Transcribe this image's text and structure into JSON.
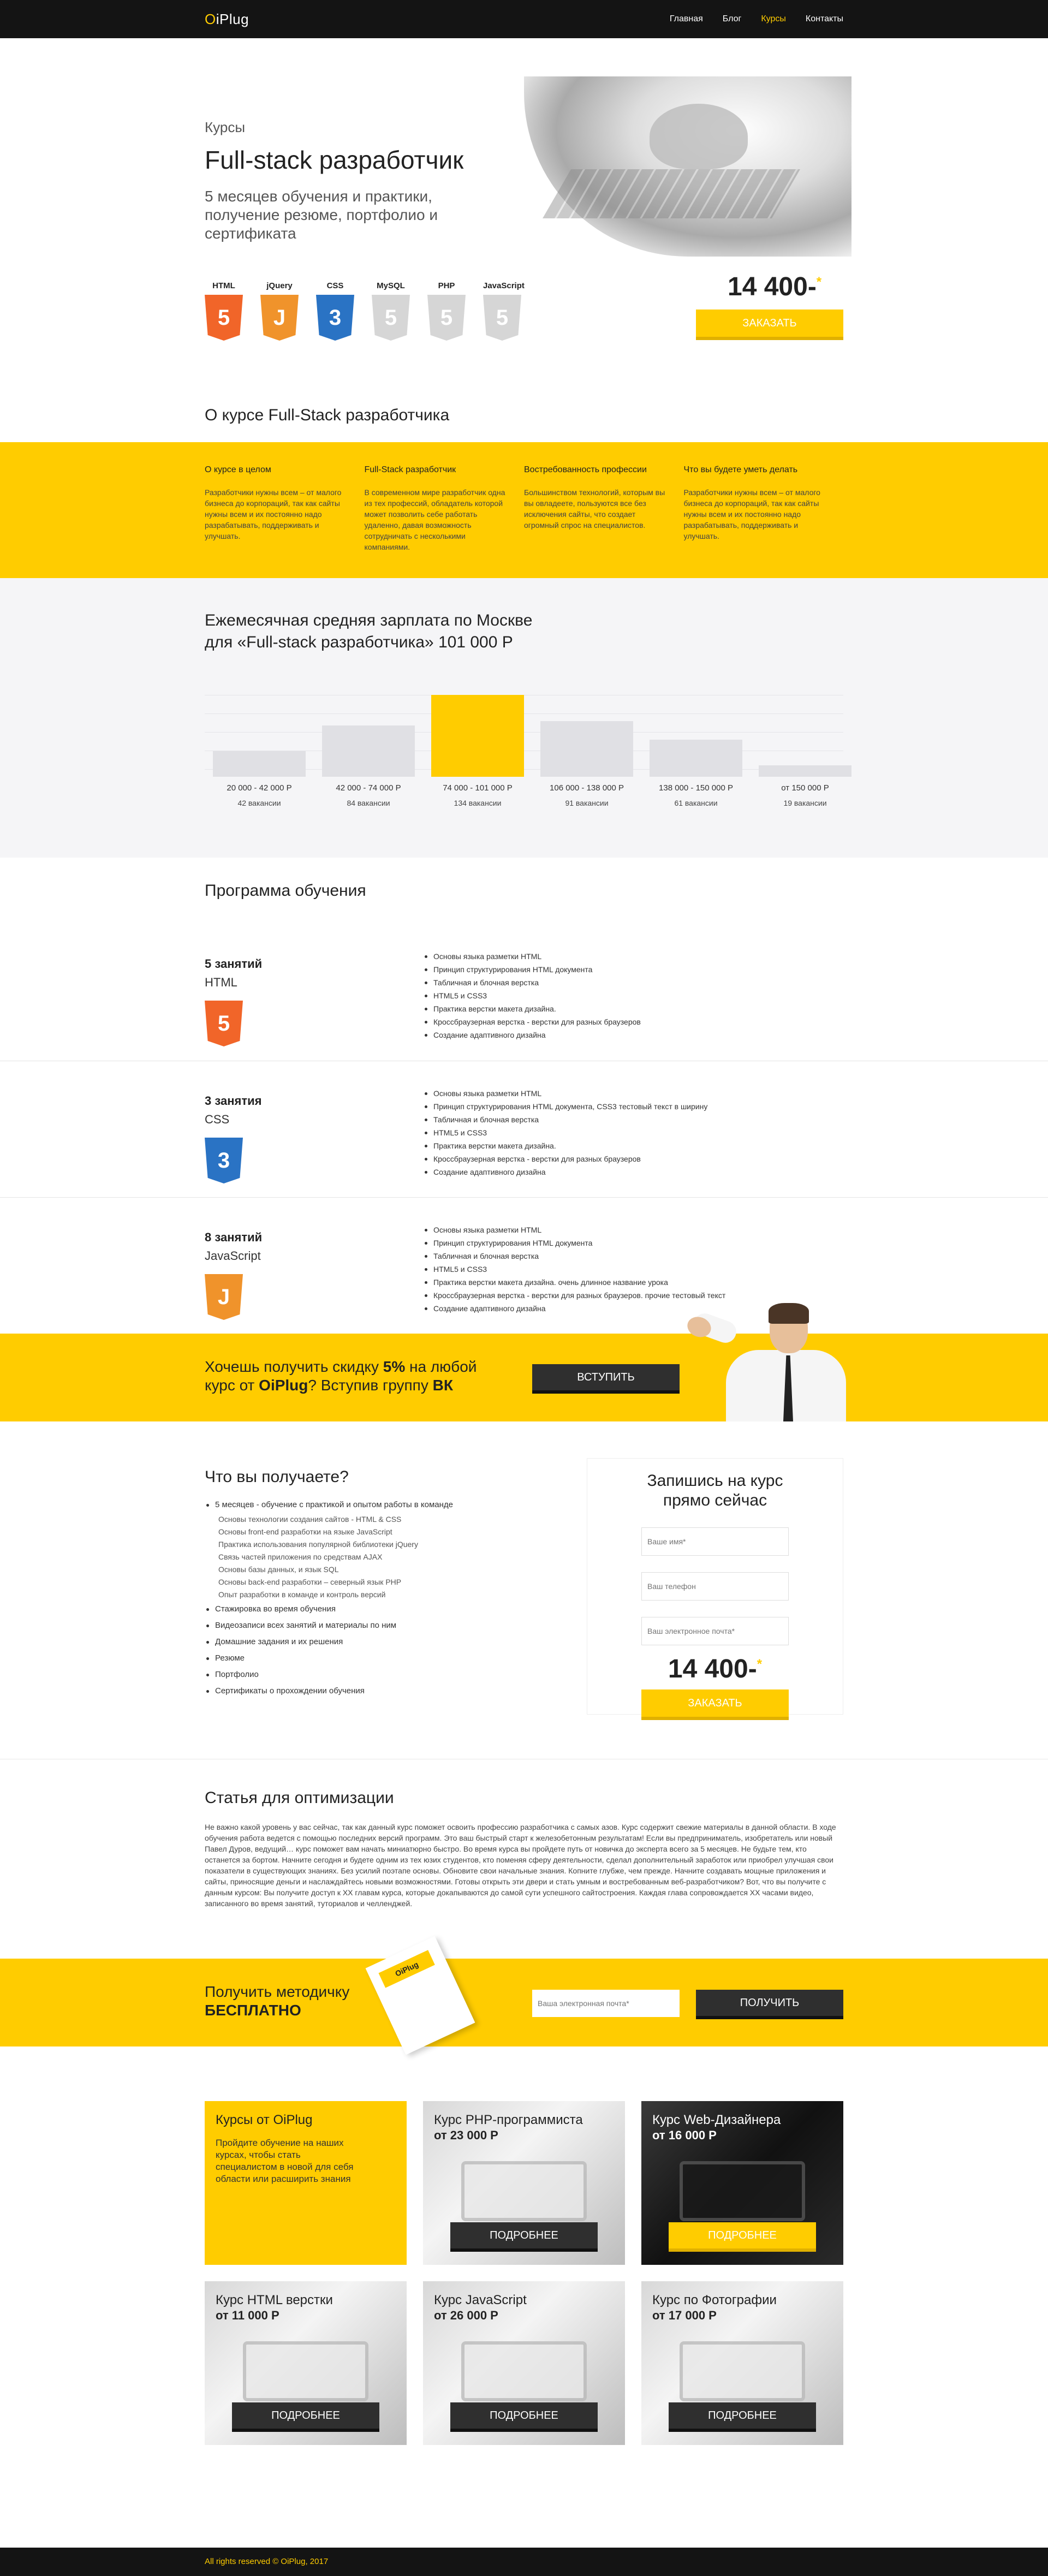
{
  "brand": {
    "logo_o": "O",
    "logo_rest": "iPlug"
  },
  "nav": {
    "items": [
      {
        "label": "Главная"
      },
      {
        "label": "Блог"
      },
      {
        "label": "Курсы"
      },
      {
        "label": "Контакты"
      }
    ]
  },
  "hero": {
    "kicker": "Курсы",
    "title": "Full-stack разработчик",
    "subtitle": "5 месяцев обучения и практики, получение резюме, портфолио и сертификата",
    "techs": [
      {
        "label": "HTML",
        "glyph": "5",
        "color": "#f16529"
      },
      {
        "label": "jQuery",
        "glyph": "J",
        "color": "#f0932b"
      },
      {
        "label": "CSS",
        "glyph": "3",
        "color": "#2a73c4"
      },
      {
        "label": "MySQL",
        "glyph": "5",
        "color": "#d6d6d6"
      },
      {
        "label": "PHP",
        "glyph": "5",
        "color": "#d6d6d6"
      },
      {
        "label": "JavaScript",
        "glyph": "5",
        "color": "#d6d6d6"
      }
    ],
    "price": "14 400-",
    "price_mark": "*",
    "order_label": "ЗАКАЗАТЬ"
  },
  "about": {
    "title": "О курсе Full-Stack разработчика",
    "cols": [
      {
        "title": "О курсе в целом",
        "text": "Разработчики нужны всем – от малого бизнеса до корпораций, так как сайты нужны всем и их постоянно надо разрабатывать, поддерживать и улучшать."
      },
      {
        "title": "Full-Stack разработчик",
        "text": "В современном мире разработчик одна из тех профессий, обладатель которой может позволить себе работать удаленно, давая возможность сотрудничать с несколькими компаниями."
      },
      {
        "title": "Востребованность профессии",
        "text": "Большинством технологий, которым вы вы овладеете, пользуются все без исключения сайты, что создает огромный спрос на специалистов."
      },
      {
        "title": "Что вы будете уметь делать",
        "text": "Разработчики нужны всем – от малого бизнеса до корпораций, так как сайты нужны всем и их постоянно надо разрабатывать, поддерживать и улучшать."
      }
    ]
  },
  "salary": {
    "title_l1": "Ежемесячная средняя зарплата по Москве",
    "title_l2": "для «Full-stack разработчика» 101 000 Р"
  },
  "chart_data": {
    "type": "bar",
    "categories": [
      "20 000 - 42 000 Р",
      "42 000 - 74 000 Р",
      "74 000 - 101 000 Р",
      "106 000 - 138 000 Р",
      "138 000 - 150 000 Р",
      "от 150 000 Р"
    ],
    "values": [
      42,
      84,
      134,
      91,
      61,
      19
    ],
    "value_labels": [
      "42 вакансии",
      "84 вакансии",
      "134 вакансии",
      "91 вакансии",
      "61 вакансии",
      "19 вакансии"
    ],
    "highlight_index": 2,
    "ylim": [
      0,
      134
    ],
    "grid": true,
    "colors": {
      "bar": "#e0e0e4",
      "highlight": "#ffcc00"
    }
  },
  "program": {
    "title": "Программа обучения",
    "items": [
      {
        "count": "5 занятий",
        "name": "HTML",
        "glyph": "5",
        "color": "#f16529",
        "topics": [
          "Основы языка разметки HTML",
          "Принцип структурирования HTML документа",
          "Табличная и блочная верстка",
          "HTML5 и CSS3",
          "Практика верстки макета дизайна.",
          "Кроссбраузерная верстка - верстки для разных браузеров",
          "Создание адаптивного дизайна"
        ]
      },
      {
        "count": "3 занятия",
        "name": "CSS",
        "glyph": "3",
        "color": "#2a73c4",
        "topics": [
          "Основы языка разметки HTML",
          "Принцип структурирования HTML документа, CSS3 тестовый текст в ширину",
          "Табличная и блочная верстка",
          "HTML5 и CSS3",
          "Практика верстки макета дизайна.",
          "Кроссбраузерная верстка - верстки для разных браузеров",
          "Создание адаптивного дизайна"
        ]
      },
      {
        "count": "8 занятий",
        "name": "JavaScript",
        "glyph": "J",
        "color": "#f0932b",
        "topics": [
          "Основы языка разметки HTML",
          "Принцип структурирования HTML документа",
          "Табличная и блочная верстка",
          "HTML5 и CSS3",
          "Практика верстки макета дизайна. очень длинное название урока",
          "Кроссбраузерная верстка - верстки для разных браузеров. прочие тестовый текст",
          "Создание адаптивного дизайна"
        ]
      }
    ]
  },
  "promo": {
    "pre": "Хочешь получить скидку ",
    "pct": "5%",
    "mid": " на любой",
    "l2_pre": "курс от ",
    "brand": "OiPlug",
    "l2_mid": "? Вступив группу ",
    "vk": "ВК",
    "join_label": "ВСТУПИТЬ"
  },
  "get": {
    "title": "Что вы получаете?",
    "first": "5 месяцев - обучение с практикой и опытом работы в команде",
    "sub": [
      "Основы технологии создания сайтов - HTML & CSS",
      "Основы front-end разработки на языке JavaScript",
      "Практика использования популярной библиотеки jQuery",
      "Связь частей приложения по средствам AJAX",
      "Основы базы данных, и язык SQL",
      "Основы back-end разработки – северный язык PHP",
      "Опыт разработки в команде и контроль версий"
    ],
    "rest": [
      "Стажировка во время обучения",
      "Видеозаписи всех занятий и материалы по ним",
      "Домашние задания и их решения",
      "Резюме",
      "Портфолио",
      "Сертификаты о прохождении обучения"
    ]
  },
  "signup": {
    "title_l1": "Запишись на курс",
    "title_l2": "прямо сейчас",
    "name_ph": "Ваше имя*",
    "phone_ph": "Ваш телефон",
    "email_ph": "Ваш электронное почта*",
    "price": "14 400-",
    "price_mark": "*",
    "order_label": "ЗАКАЗАТЬ"
  },
  "article": {
    "title": "Статья для оптимизации",
    "text": "Не важно какой уровень у вас сейчас, так как данный курс поможет освоить профессию разработчика с самых азов. Курс содержит свежие материалы в данной области. В ходе обучения работа ведется с помощью последних версий программ. Это ваш быстрый старт к железобетонным результатам! Если вы предприниматель, изобретатель или новый Павел Дуров, ведущий… курс поможет вам начать миниатюрно быстро. Во время курса вы пройдете путь от новичка до эксперта всего за 5 месяцев. Не будьте тем, кто останется за бортом. Начните сегодня и будете одним из тех юзих студентов, кто поменяя сферу деятельности, сделал дополнительный заработок или приобрел улучшая свои показатели в существующих знаниях. Без усилий поэтапе основы. Обновите свои начальные знания. Копните глубже, чем прежде. Начните создавать мощные приложения и сайты, приносящие деньги и наслаждайтесь новыми возможностями. Готовы открыть эти двери и стать умным и востребованным веб-разработчиком? Вот, что вы получите с данным курсом: Вы получите доступ к XX главам курса, которые докапываются до самой сути успешного сайтостроения. Каждая глава сопровождается XX часами видео, записанного во время занятий, туториалов и челленджей."
  },
  "method": {
    "l1": "Получить методичку",
    "l2": "БЕСПЛАТНО",
    "book_label": "OiPlug",
    "email_ph": "Ваша электронная почта*",
    "get_label": "ПОЛУЧИТЬ"
  },
  "courses": {
    "intro": {
      "title": "Курсы от OiPlug",
      "text": "Пройдите обучение на наших курсах, чтобы стать специалистом в новой для себя области или расширить знания"
    },
    "items": [
      {
        "title": "Курс PHP-программиста",
        "price": "от 23 000 Р",
        "more": "ПОДРОБНЕЕ"
      },
      {
        "title": "Курс Web-Дизайнера",
        "price": "от 16 000 Р",
        "more": "ПОДРОБНЕЕ"
      },
      {
        "title": "Курс HTML верстки",
        "price": "от 11 000 Р",
        "more": "ПОДРОБНЕЕ"
      },
      {
        "title": "Курс JavaScript",
        "price": "от 26 000 Р",
        "more": "ПОДРОБНЕЕ"
      },
      {
        "title": "Курс по Фотографии",
        "price": "от 17 000 Р",
        "more": "ПОДРОБНЕЕ"
      }
    ]
  },
  "footer": {
    "text": "All rights reserved © OiPlug, 2017"
  }
}
